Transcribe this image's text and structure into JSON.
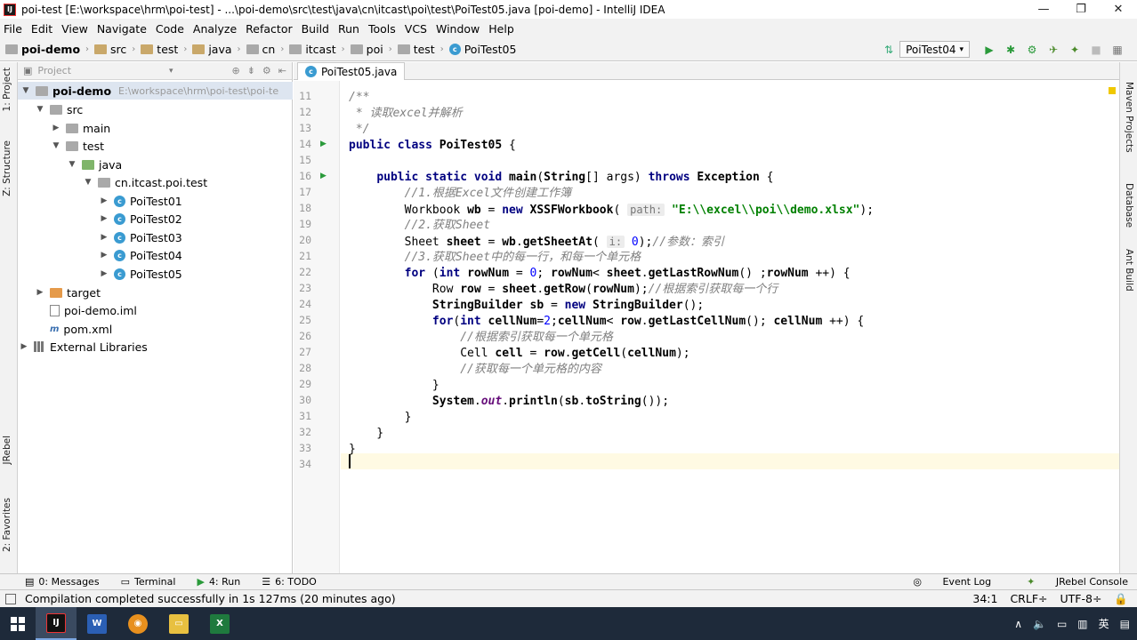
{
  "window": {
    "title": "poi-test [E:\\workspace\\hrm\\poi-test] - ...\\poi-demo\\src\\test\\java\\cn\\itcast\\poi\\test\\PoiTest05.java [poi-demo] - IntelliJ IDEA",
    "minimize": "—",
    "maximize": "❐",
    "close": "✕"
  },
  "menu": [
    "File",
    "Edit",
    "View",
    "Navigate",
    "Code",
    "Analyze",
    "Refactor",
    "Build",
    "Run",
    "Tools",
    "VCS",
    "Window",
    "Help"
  ],
  "breadcrumb": [
    "poi-demo",
    "src",
    "test",
    "java",
    "cn",
    "itcast",
    "poi",
    "test",
    "PoiTest05"
  ],
  "run_config": "PoiTest04",
  "left_strip": {
    "project": "1: Project",
    "structure": "Z: Structure",
    "jrebel": "JRebel",
    "favorites": "2: Favorites"
  },
  "right_strip": {
    "maven": "Maven Projects",
    "database": "Database",
    "ant": "Ant Build"
  },
  "project_panel": {
    "header": "Project",
    "root": "poi-demo",
    "root_path": "E:\\workspace\\hrm\\poi-test\\poi-te",
    "items": {
      "src": "src",
      "main": "main",
      "test": "test",
      "java": "java",
      "package": "cn.itcast.poi.test",
      "c1": "PoiTest01",
      "c2": "PoiTest02",
      "c3": "PoiTest03",
      "c4": "PoiTest04",
      "c5": "PoiTest05",
      "target": "target",
      "iml": "poi-demo.iml",
      "pom": "pom.xml",
      "libs": "External Libraries"
    }
  },
  "editor": {
    "tab": "PoiTest05.java",
    "line_numbers": [
      "11",
      "12",
      "13",
      "14",
      "15",
      "16",
      "17",
      "18",
      "19",
      "20",
      "21",
      "22",
      "23",
      "24",
      "25",
      "26",
      "27",
      "28",
      "29",
      "30",
      "31",
      "32",
      "33",
      "34"
    ],
    "code": {
      "l11": "/**",
      "l12": " * 读取excel并解析",
      "l13": " */",
      "l17": "//1.根据Excel文件创建工作簿",
      "l18_hint": "path:",
      "l18_str": "\"E:\\\\excel\\\\poi\\\\demo.xlsx\"",
      "l19": "//2.获取Sheet",
      "l20_hint": "i:",
      "l20_cm": "//参数：索引",
      "l21": "//3.获取Sheet中的每一行，和每一个单元格",
      "l23_cm": "//根据索引获取每一个行",
      "l26": "//根据索引获取每一个单元格",
      "l28": "//获取每一个单元格的内容"
    }
  },
  "bottom_tabs": {
    "messages": "0: Messages",
    "terminal": "Terminal",
    "run": "4: Run",
    "todo": "6: TODO",
    "eventlog": "Event Log",
    "jrebel": "JRebel Console"
  },
  "status": {
    "message": "Compilation completed successfully in 1s 127ms (20 minutes ago)",
    "position": "34:1",
    "line_sep": "CRLF÷",
    "encoding": "UTF-8÷"
  }
}
